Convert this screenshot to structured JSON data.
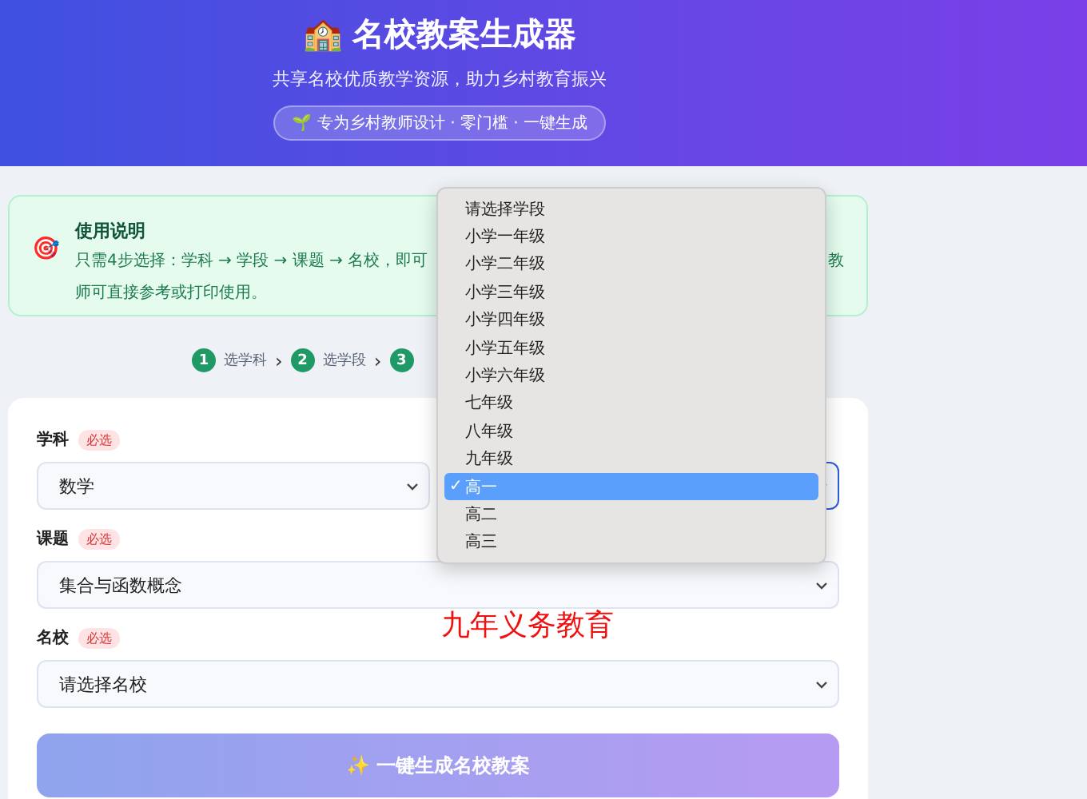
{
  "header": {
    "logo": "🏫",
    "title": "名校教案生成器",
    "subtitle": "共享名校优质教学资源，助力乡村教育振兴",
    "badge_icon": "🌱",
    "badge": "专为乡村教师设计 · 零门槛 · 一键生成"
  },
  "info": {
    "icon": "🎯",
    "title": "使用说明",
    "line1_start": "只需4步选择：学科 → 学段 → 课题 → 名校，即可",
    "line1_end": "教",
    "line2": "师可直接参考或打印使用。"
  },
  "steps": [
    {
      "number": "1",
      "label": "选学科",
      "separator": "›"
    },
    {
      "number": "2",
      "label": "选学段",
      "separator": "›"
    },
    {
      "number": "3"
    }
  ],
  "form": {
    "fields": [
      {
        "label": "学科",
        "tag": "必选",
        "value": "数学",
        "focused": false
      },
      {
        "focused": true
      },
      {
        "label": "课题",
        "tag": "必选",
        "value": "集合与函数概念",
        "focused": false
      },
      {
        "label": "名校",
        "tag": "必选",
        "value": "请选择名校",
        "focused": false
      }
    ],
    "submit": "✨ 一键生成名校教案"
  },
  "dropdown": {
    "check": "✓",
    "options": [
      {
        "label": "请选择学段",
        "selected": false
      },
      {
        "label": "小学一年级",
        "selected": false
      },
      {
        "label": "小学二年级",
        "selected": false
      },
      {
        "label": "小学三年级",
        "selected": false
      },
      {
        "label": "小学四年级",
        "selected": false
      },
      {
        "label": "小学五年级",
        "selected": false
      },
      {
        "label": "小学六年级",
        "selected": false
      },
      {
        "label": "七年级",
        "selected": false
      },
      {
        "label": "八年级",
        "selected": false
      },
      {
        "label": "九年级",
        "selected": false
      },
      {
        "label": "高一",
        "selected": true
      },
      {
        "label": "高二",
        "selected": false
      },
      {
        "label": "高三",
        "selected": false
      }
    ]
  },
  "annotation": "九年义务教育"
}
